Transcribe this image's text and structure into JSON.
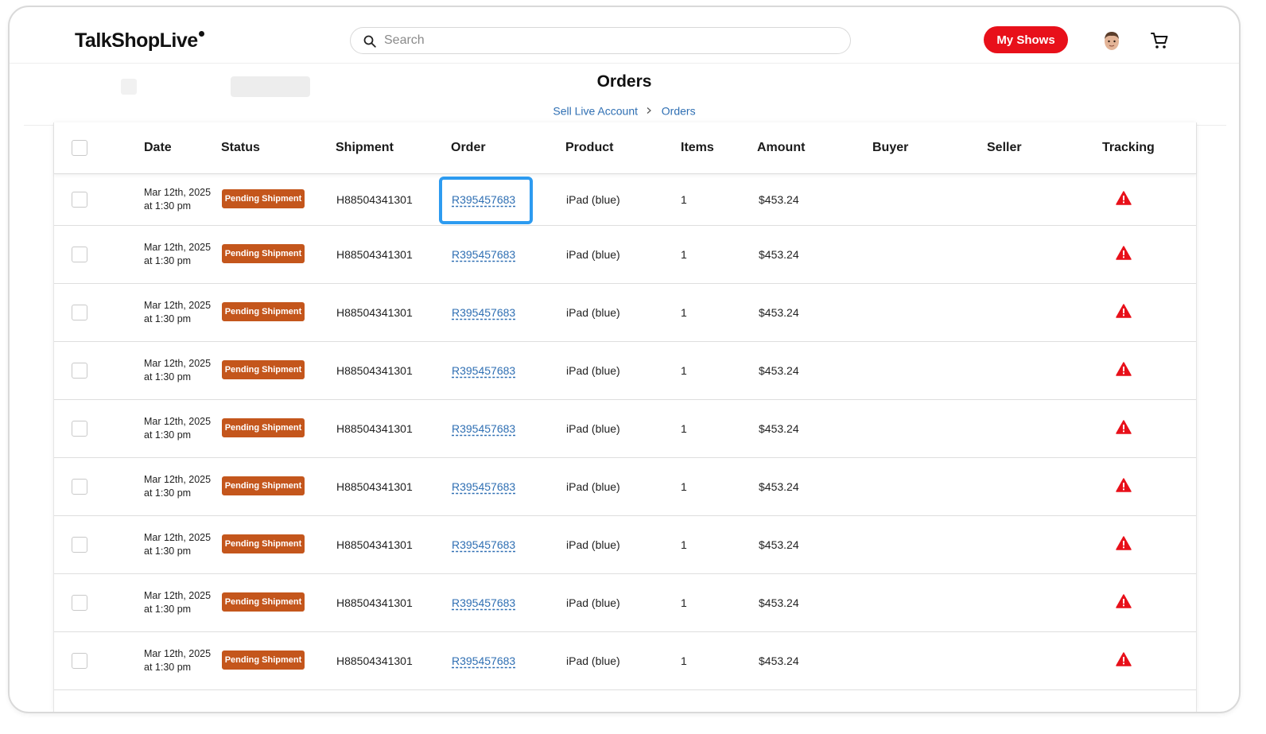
{
  "header": {
    "logo": "TalkShopLive",
    "search_placeholder": "Search",
    "my_shows_label": "My Shows",
    "brand_color": "#e8101a"
  },
  "page": {
    "title": "Orders",
    "breadcrumb": [
      "Sell Live Account",
      "Orders"
    ]
  },
  "table": {
    "columns": [
      "Date",
      "Status",
      "Shipment",
      "Order",
      "Product",
      "Items",
      "Amount",
      "Buyer",
      "Seller",
      "Tracking"
    ],
    "tracking_icon": "warning-icon",
    "rows": [
      {
        "date": "Mar 12th, 2025",
        "time": "at 1:30 pm",
        "status": "Pending Shipment",
        "shipment": "H88504341301",
        "order": "R395457683",
        "product": "iPad (blue)",
        "items": "1",
        "amount": "$453.24",
        "buyer": "",
        "seller": ""
      },
      {
        "date": "Mar 12th, 2025",
        "time": "at 1:30 pm",
        "status": "Pending Shipment",
        "shipment": "H88504341301",
        "order": "R395457683",
        "product": "iPad (blue)",
        "items": "1",
        "amount": "$453.24",
        "buyer": "",
        "seller": ""
      },
      {
        "date": "Mar 12th, 2025",
        "time": "at 1:30 pm",
        "status": "Pending Shipment",
        "shipment": "H88504341301",
        "order": "R395457683",
        "product": "iPad (blue)",
        "items": "1",
        "amount": "$453.24",
        "buyer": "",
        "seller": ""
      },
      {
        "date": "Mar 12th, 2025",
        "time": "at 1:30 pm",
        "status": "Pending Shipment",
        "shipment": "H88504341301",
        "order": "R395457683",
        "product": "iPad (blue)",
        "items": "1",
        "amount": "$453.24",
        "buyer": "",
        "seller": ""
      },
      {
        "date": "Mar 12th, 2025",
        "time": "at 1:30 pm",
        "status": "Pending Shipment",
        "shipment": "H88504341301",
        "order": "R395457683",
        "product": "iPad (blue)",
        "items": "1",
        "amount": "$453.24",
        "buyer": "",
        "seller": ""
      },
      {
        "date": "Mar 12th, 2025",
        "time": "at 1:30 pm",
        "status": "Pending Shipment",
        "shipment": "H88504341301",
        "order": "R395457683",
        "product": "iPad (blue)",
        "items": "1",
        "amount": "$453.24",
        "buyer": "",
        "seller": ""
      },
      {
        "date": "Mar 12th, 2025",
        "time": "at 1:30 pm",
        "status": "Pending Shipment",
        "shipment": "H88504341301",
        "order": "R395457683",
        "product": "iPad (blue)",
        "items": "1",
        "amount": "$453.24",
        "buyer": "",
        "seller": ""
      },
      {
        "date": "Mar 12th, 2025",
        "time": "at 1:30 pm",
        "status": "Pending Shipment",
        "shipment": "H88504341301",
        "order": "R395457683",
        "product": "iPad (blue)",
        "items": "1",
        "amount": "$453.24",
        "buyer": "",
        "seller": ""
      },
      {
        "date": "Mar 12th, 2025",
        "time": "at 1:30 pm",
        "status": "Pending Shipment",
        "shipment": "H88504341301",
        "order": "R395457683",
        "product": "iPad (blue)",
        "items": "1",
        "amount": "$453.24",
        "buyer": "",
        "seller": ""
      }
    ]
  },
  "colors": {
    "status_badge": "#c4561c",
    "link": "#2f6fb3",
    "highlight": "#2d9bf0",
    "warning": "#e8101a"
  }
}
